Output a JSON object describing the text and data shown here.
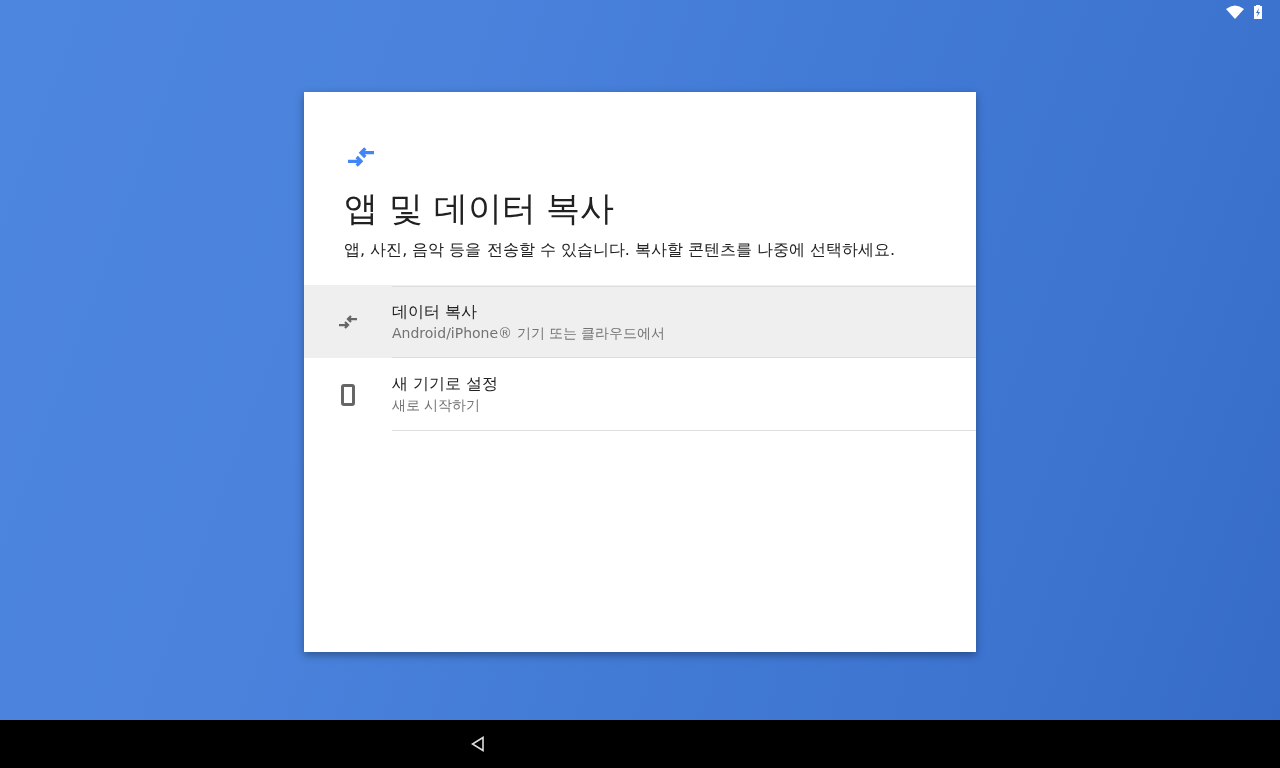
{
  "dialog": {
    "title": "앱 및 데이터 복사",
    "subtitle": "앱, 사진, 음악 등을 전송할 수 있습니다. 복사할 콘텐츠를 나중에 선택하세요.",
    "options": [
      {
        "kind": "transfer",
        "title": "데이터 복사",
        "summary": "Android/iPhone® 기기 또는 클라우드에서",
        "selected": true
      },
      {
        "kind": "phone",
        "title": "새 기기로 설정",
        "summary": "새로 시작하기",
        "selected": false
      }
    ]
  }
}
